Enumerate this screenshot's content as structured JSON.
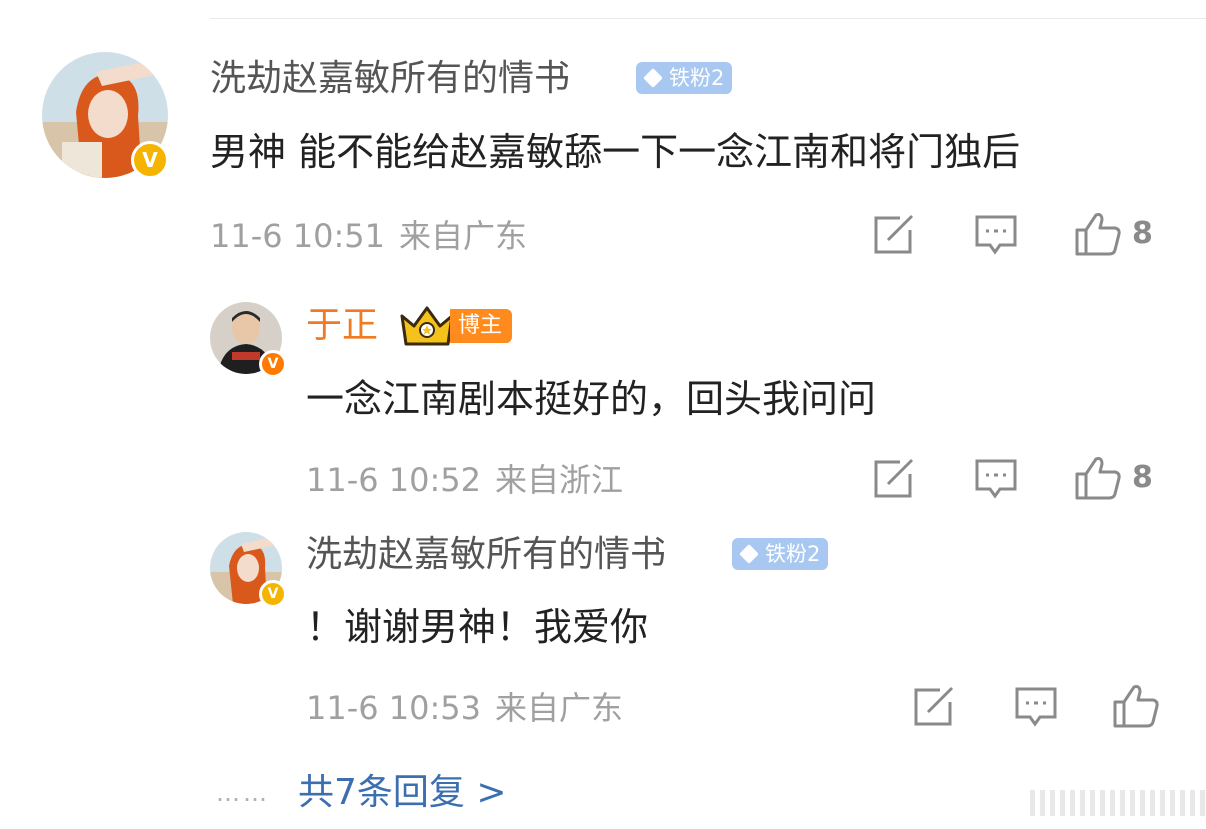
{
  "comments": [
    {
      "author": "洗劫赵嘉敏所有的情书",
      "fan_badge": "铁粉2",
      "text": "男神 能不能给赵嘉敏舔一下一念江南和将门独后",
      "date": "11-6 10:51",
      "location": "来自广东",
      "likes": "8"
    },
    {
      "author": "于正",
      "host_badge": "博主",
      "text": "一念江南剧本挺好的，回头我问问",
      "date": "11-6 10:52",
      "location": "来自浙江",
      "likes": "8"
    },
    {
      "author": "洗劫赵嘉敏所有的情书",
      "fan_badge": "铁粉2",
      "text": "！谢谢男神！我爱你",
      "date": "11-6 10:53",
      "location": "来自广东",
      "likes": ""
    }
  ],
  "more_replies": {
    "dots": "……",
    "label": "共7条回复 >"
  },
  "icons": {
    "repost": "repost-icon",
    "comment": "comment-icon",
    "like": "thumbs-up-icon",
    "verified": "verified-v-icon",
    "crown": "crown-icon"
  },
  "colors": {
    "host_name": "#f07b24",
    "link": "#3b6fb0",
    "fan_badge": "#a8c8f2",
    "verified_gold": "#f5b400"
  }
}
